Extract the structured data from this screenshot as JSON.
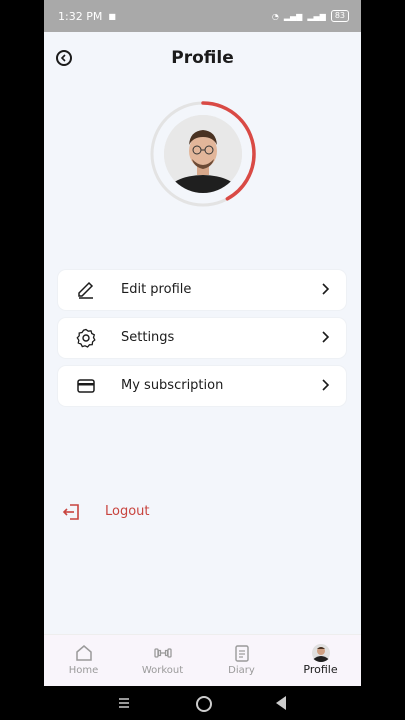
{
  "status": {
    "time": "1:32 PM",
    "battery": "83"
  },
  "header": {
    "title": "Profile"
  },
  "profile": {
    "progress": 0.42,
    "ring_color": "#d94a45"
  },
  "menu": [
    {
      "label": "Edit profile",
      "icon": "pencil-icon"
    },
    {
      "label": "Settings",
      "icon": "gear-icon"
    },
    {
      "label": "My subscription",
      "icon": "credit-card-icon"
    }
  ],
  "logout": {
    "label": "Logout",
    "color": "#c8443e"
  },
  "tabs": [
    {
      "label": "Home",
      "icon": "home-icon"
    },
    {
      "label": "Workout",
      "icon": "dumbbell-icon"
    },
    {
      "label": "Diary",
      "icon": "notebook-icon"
    },
    {
      "label": "Profile",
      "icon": "avatar-icon",
      "active": true
    }
  ]
}
